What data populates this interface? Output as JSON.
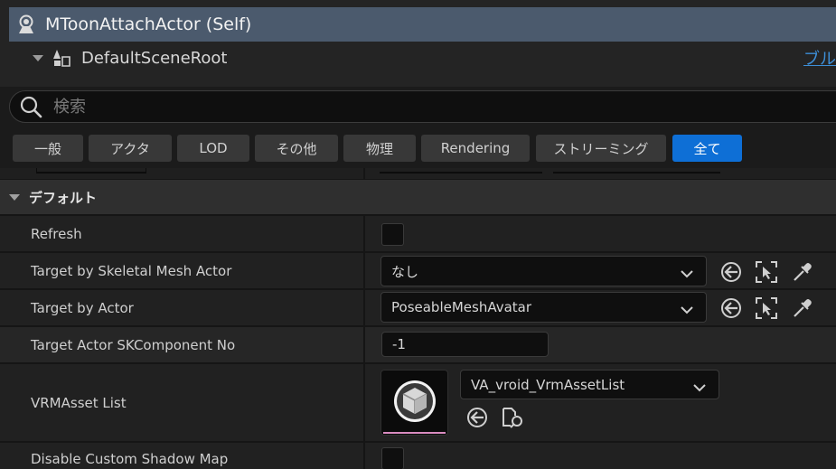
{
  "components": {
    "self_label": "MToonAttachActor (Self)",
    "root_label": "DefaultSceneRoot",
    "blueprint_link": "ブル"
  },
  "search": {
    "placeholder": "検索"
  },
  "filters": [
    {
      "label": "一般",
      "active": false
    },
    {
      "label": "アクタ",
      "active": false
    },
    {
      "label": "LOD",
      "active": false
    },
    {
      "label": "その他",
      "active": false
    },
    {
      "label": "物理",
      "active": false
    },
    {
      "label": "Rendering",
      "active": false
    },
    {
      "label": "ストリーミング",
      "active": false
    },
    {
      "label": "全て",
      "active": true
    }
  ],
  "category": {
    "label": "デフォルト"
  },
  "properties": {
    "refresh": {
      "name": "Refresh",
      "checked": false
    },
    "target_skeletal": {
      "name": "Target by Skeletal Mesh Actor",
      "value": "なし"
    },
    "target_actor": {
      "name": "Target by Actor",
      "value": "PoseableMeshAvatar"
    },
    "sk_component_no": {
      "name": "Target Actor SKComponent No",
      "value": "-1"
    },
    "vrm_asset_list": {
      "name": "VRMAsset List",
      "value": "VA_vroid_VrmAssetList"
    },
    "disable_shadow": {
      "name": "Disable Custom Shadow Map",
      "checked": false
    }
  },
  "icons": {
    "self": "actor-self-icon",
    "root": "scene-root-icon",
    "search": "search-icon",
    "reset": "use-selected-arrow-icon",
    "browse": "select-in-viewport-icon",
    "pick": "eyedropper-icon",
    "find": "browse-asset-icon",
    "thumbnail": "cube-asset-icon"
  },
  "colors": {
    "selected_row": "#4b5a6d",
    "active_filter": "#0e6fd6",
    "link": "#3d8fd8",
    "thumbnail_underline": "#d98cc0"
  }
}
